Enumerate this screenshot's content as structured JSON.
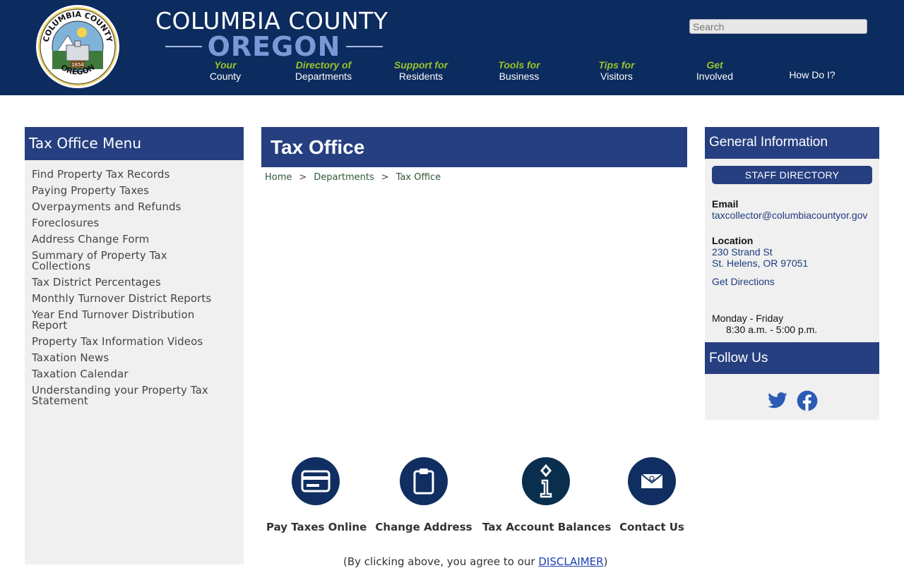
{
  "header": {
    "brand_line1": "COLUMBIA COUNTY",
    "brand_line2": "OREGON",
    "search_placeholder": "Search",
    "seal": {
      "top_text": "COLUMBIA COUNTY",
      "bottom_text": "OREGON",
      "year": "1854"
    },
    "nav": [
      {
        "top": "Your",
        "bottom": "County"
      },
      {
        "top": "Directory of",
        "bottom": "Departments"
      },
      {
        "top": "Support for",
        "bottom": "Residents"
      },
      {
        "top": "Tools for",
        "bottom": "Business"
      },
      {
        "top": "Tips for",
        "bottom": "Visitors"
      },
      {
        "top": "Get",
        "bottom": "Involved"
      },
      {
        "top": "",
        "bottom": "How Do I?"
      }
    ]
  },
  "sidebar": {
    "title": "Tax Office Menu",
    "items": [
      "Find Property Tax Records",
      "Paying Property Taxes",
      "Overpayments and Refunds",
      "Foreclosures",
      "Address Change Form",
      "Summary of Property Tax Collections",
      "Tax District Percentages",
      "Monthly Turnover District Reports",
      "Year End Turnover Distribution Report",
      "Property Tax Information Videos",
      "Taxation News",
      "Taxation Calendar",
      "Understanding your Property Tax Statement"
    ]
  },
  "main": {
    "title": "Tax Office",
    "breadcrumb": [
      "Home",
      "Departments",
      "Tax Office"
    ],
    "breadcrumb_sep": ">",
    "quick_links": [
      {
        "label": "Pay Taxes Online",
        "icon": "credit-card-icon"
      },
      {
        "label": "Change Address",
        "icon": "clipboard-icon"
      },
      {
        "label": "Tax Account Balances",
        "icon": "info-icon"
      },
      {
        "label": "Contact Us",
        "icon": "envelope-icon"
      }
    ],
    "disclaimer_pre": "(By clicking above, you agree to our ",
    "disclaimer_link": "DISCLAIMER",
    "disclaimer_post": ")"
  },
  "info": {
    "title": "General Information",
    "staff_button": "STAFF DIRECTORY",
    "email_label": "Email",
    "email": "taxcollector@columbiacountyor.gov",
    "location_label": "Location",
    "address1": "230 Strand St",
    "address2": "St. Helens, OR 97051",
    "directions": "Get Directions",
    "hours_days": "Monday - Friday",
    "hours_time": "8:30 a.m. - 5:00 p.m.",
    "follow_title": "Follow Us",
    "social_color": "#2a5bb5"
  },
  "colors": {
    "header_bg": "#0c2b5e",
    "panel_head": "#263f80",
    "nav_accent": "#9ac42b",
    "oregon_word": "#7b99d6"
  }
}
